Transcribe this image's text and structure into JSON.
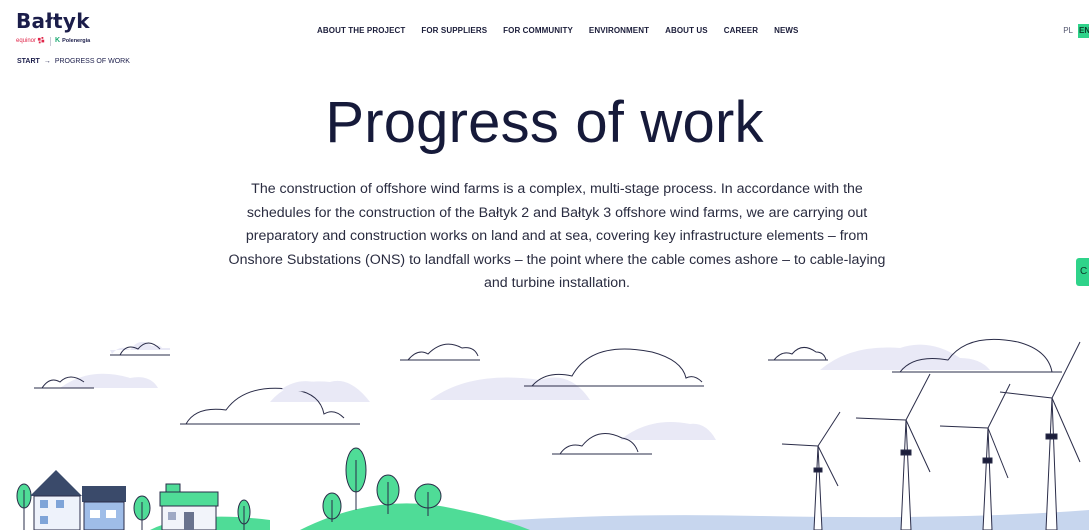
{
  "brand": {
    "logo": "Bałtyk",
    "partner_1": "equinor",
    "partner_2": "Polenergia",
    "partner_2_mark": "K"
  },
  "breadcrumb": {
    "start": "START",
    "separator": "→",
    "current": "PROGRESS OF WORK"
  },
  "nav": {
    "items": [
      "ABOUT THE PROJECT",
      "FOR SUPPLIERS",
      "FOR COMMUNITY",
      "ENVIRONMENT",
      "ABOUT US",
      "CAREER",
      "NEWS"
    ]
  },
  "language": {
    "pl": "PL",
    "en": "EN",
    "active": "EN"
  },
  "side_tab": {
    "label": "C"
  },
  "page": {
    "title": "Progress of work",
    "intro": "The construction of offshore wind farms is a complex, multi-stage process. In accordance with the schedules for the construction of the Bałtyk 2 and Bałtyk 3 offshore wind farms, we are carrying out preparatory and construction works on land and at sea, covering key infrastructure elements – from Onshore Substations (ONS) to landfall works – the point where the cable comes ashore – to cable-laying and turbine installation."
  },
  "colors": {
    "accent": "#2fd38a",
    "navy": "#1b1d4a",
    "equinor_red": "#e0264a",
    "cloud_fill": "#e9e9f6",
    "sea": "#c7d6ee",
    "hill": "#4fdc97"
  },
  "icons": {
    "equinor_mark": "equinor-star-icon",
    "breadcrumb_separator": "arrow-right-icon"
  }
}
